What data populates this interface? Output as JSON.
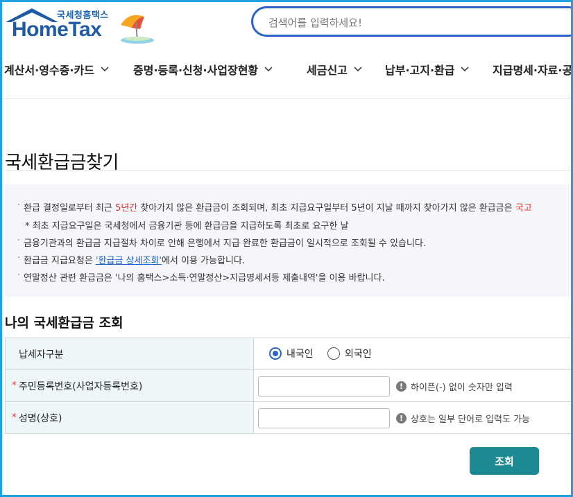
{
  "logo": {
    "sub": "국세청홈택스",
    "main": "HomeTax"
  },
  "search": {
    "placeholder": "검색어를 입력하세요!"
  },
  "gnb": [
    {
      "label": "계산서·영수증·카드"
    },
    {
      "label": "증명·등록·신청·사업장현황"
    },
    {
      "label": "세금신고"
    },
    {
      "label": "납부·고지·환급"
    },
    {
      "label": "지급명세·자료·공"
    }
  ],
  "page": {
    "title": "국세환급금찾기"
  },
  "notice": {
    "line1_pre": "환급 결정일로부터 최근 ",
    "line1_red": "5년간",
    "line1_post": " 찾아가지 않은 환급금이 조회되며, 최초 지급요구일부터 5년이 지날 때까지 찾아가지 않은 환급금은 ",
    "line1_red2": "국고",
    "line2": "* 최초 지급요구일은 국세청에서 금융기관 등에 환급금을 지급하도록 최초로 요구한 날",
    "line3": "금융기관과의 환급금 지급절차 차이로 인해 은행에서 지급 완료한 환급금이 일시적으로 조회될 수 있습니다.",
    "line4_pre": "환급금 지급요청은 ",
    "line4_link": "'환급금 상세조회'",
    "line4_post": "에서 이용 가능합니다.",
    "line5": "연말정산 관련 환급금은 '나의 홈택스>소득·연말정산>지급명세서등 제출내역'을 이용 바랍니다."
  },
  "section": {
    "title": "나의 국세환급금 조회"
  },
  "form": {
    "taxpayer_label": "납세자구분",
    "radio_domestic": "내국인",
    "radio_foreign": "외국인",
    "selected": "내국인",
    "id_label": "주민등록번호(사업자등록번호)",
    "id_hint": "하이픈(-) 없이 숫자만 입력",
    "name_label": "성명(상호)",
    "name_hint": "상호는 일부 단어로 입력도 가능",
    "required_mark": "*",
    "info_mark": "!"
  },
  "button": {
    "label": "조회"
  }
}
